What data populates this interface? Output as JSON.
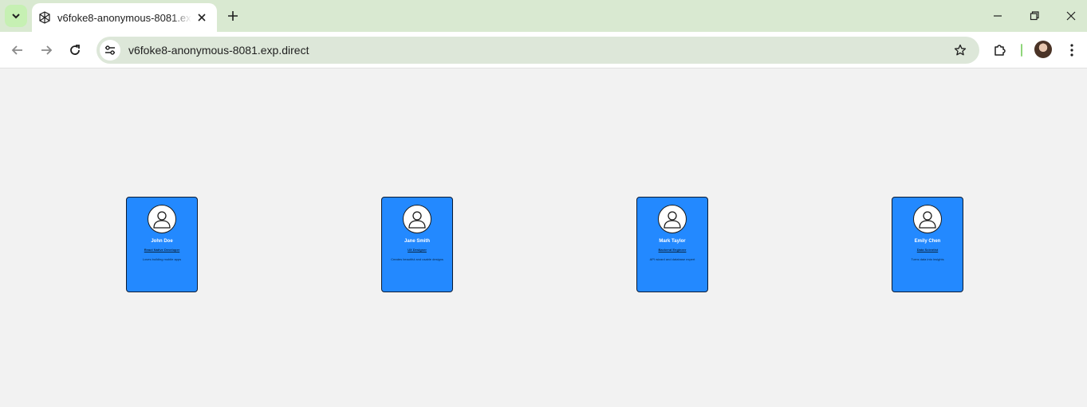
{
  "browser": {
    "tab": {
      "title": "v6foke8-anonymous-8081.exp.direct"
    },
    "omnibox": {
      "url": "v6foke8-anonymous-8081.exp.direct"
    }
  },
  "icons": {
    "tab_search": "chevron-down-icon",
    "favicon": "expo-logo-icon",
    "tab_close": "close-icon",
    "new_tab": "plus-icon",
    "minimize": "minimize-icon",
    "restore": "restore-icon",
    "close_window": "close-icon",
    "back": "arrow-left-icon",
    "forward": "arrow-right-icon",
    "reload": "reload-icon",
    "site_info": "tune-icon",
    "bookmark": "star-icon",
    "extensions": "puzzle-icon",
    "menu": "more-vert-icon",
    "card_avatar": "user-outline-icon"
  },
  "colors": {
    "tabstrip": "#d9e9d1",
    "omnibox": "#dde7d9",
    "page_bg": "#f2f2f2",
    "card_bg": "#2389ff"
  },
  "profiles": [
    {
      "name": "John Doe",
      "role": "React Native Developer",
      "description": "Loves building mobile apps"
    },
    {
      "name": "Jane Smith",
      "role": "UX Designer",
      "description": "Creates beautiful and usable designs"
    },
    {
      "name": "Mark Taylor",
      "role": "Backend Engineer",
      "description": "API wizard and database expert"
    },
    {
      "name": "Emily Chen",
      "role": "Data Scientist",
      "description": "Turns data into insights"
    }
  ]
}
